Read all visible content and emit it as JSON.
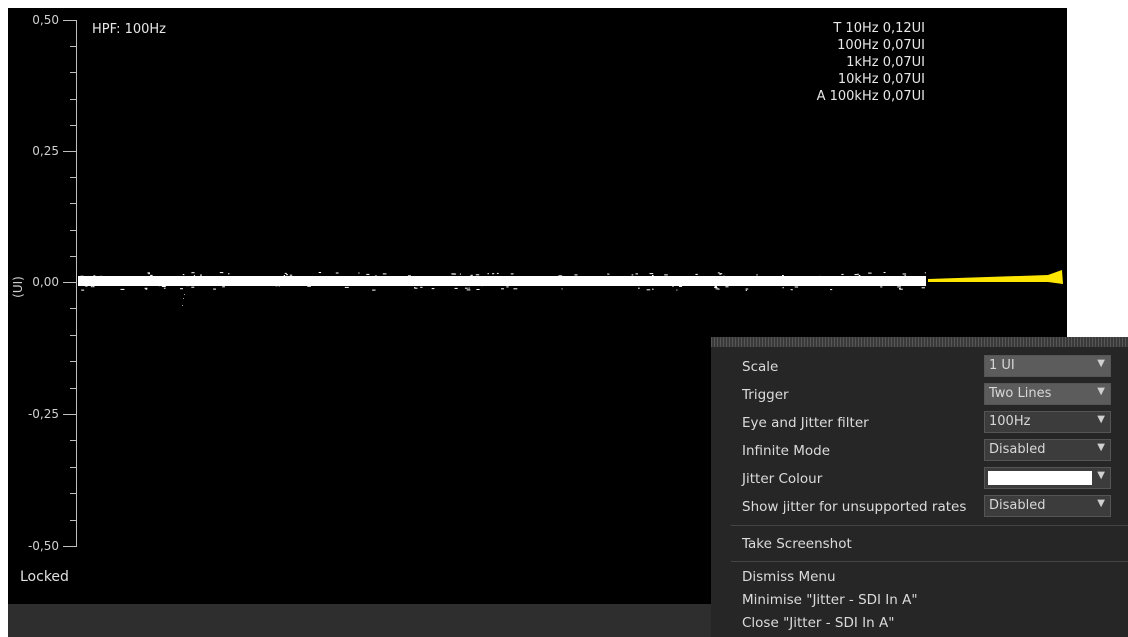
{
  "plot": {
    "hpf_label": "HPF: 100Hz",
    "axis_unit": "(UI)",
    "y_ticks": [
      "0,50",
      "0,25",
      "0,00",
      "-0,25",
      "-0,50"
    ],
    "status": "Locked",
    "readouts": [
      "T 10Hz 0,12UI",
      "100Hz 0,07UI",
      "1kHz 0,07UI",
      "10kHz 0,07UI",
      "A 100kHz 0,07UI"
    ],
    "trace_color": "#ffffff",
    "histogram_color": "#ffe600"
  },
  "menu": {
    "items": [
      {
        "label": "Scale",
        "value": "1 UI"
      },
      {
        "label": "Trigger",
        "value": "Two Lines"
      },
      {
        "label": "Eye and Jitter filter",
        "value": "100Hz"
      },
      {
        "label": "Infinite Mode",
        "value": "Disabled"
      },
      {
        "label": "Jitter Colour",
        "value": "",
        "swatch": "#ffffff"
      },
      {
        "label": "Show jitter for unsupported rates",
        "value": "Disabled"
      }
    ],
    "take_screenshot": "Take Screenshot",
    "dismiss": "Dismiss Menu",
    "minimise": "Minimise \"Jitter - SDI In A\"",
    "close": "Close \"Jitter - SDI In A\""
  }
}
